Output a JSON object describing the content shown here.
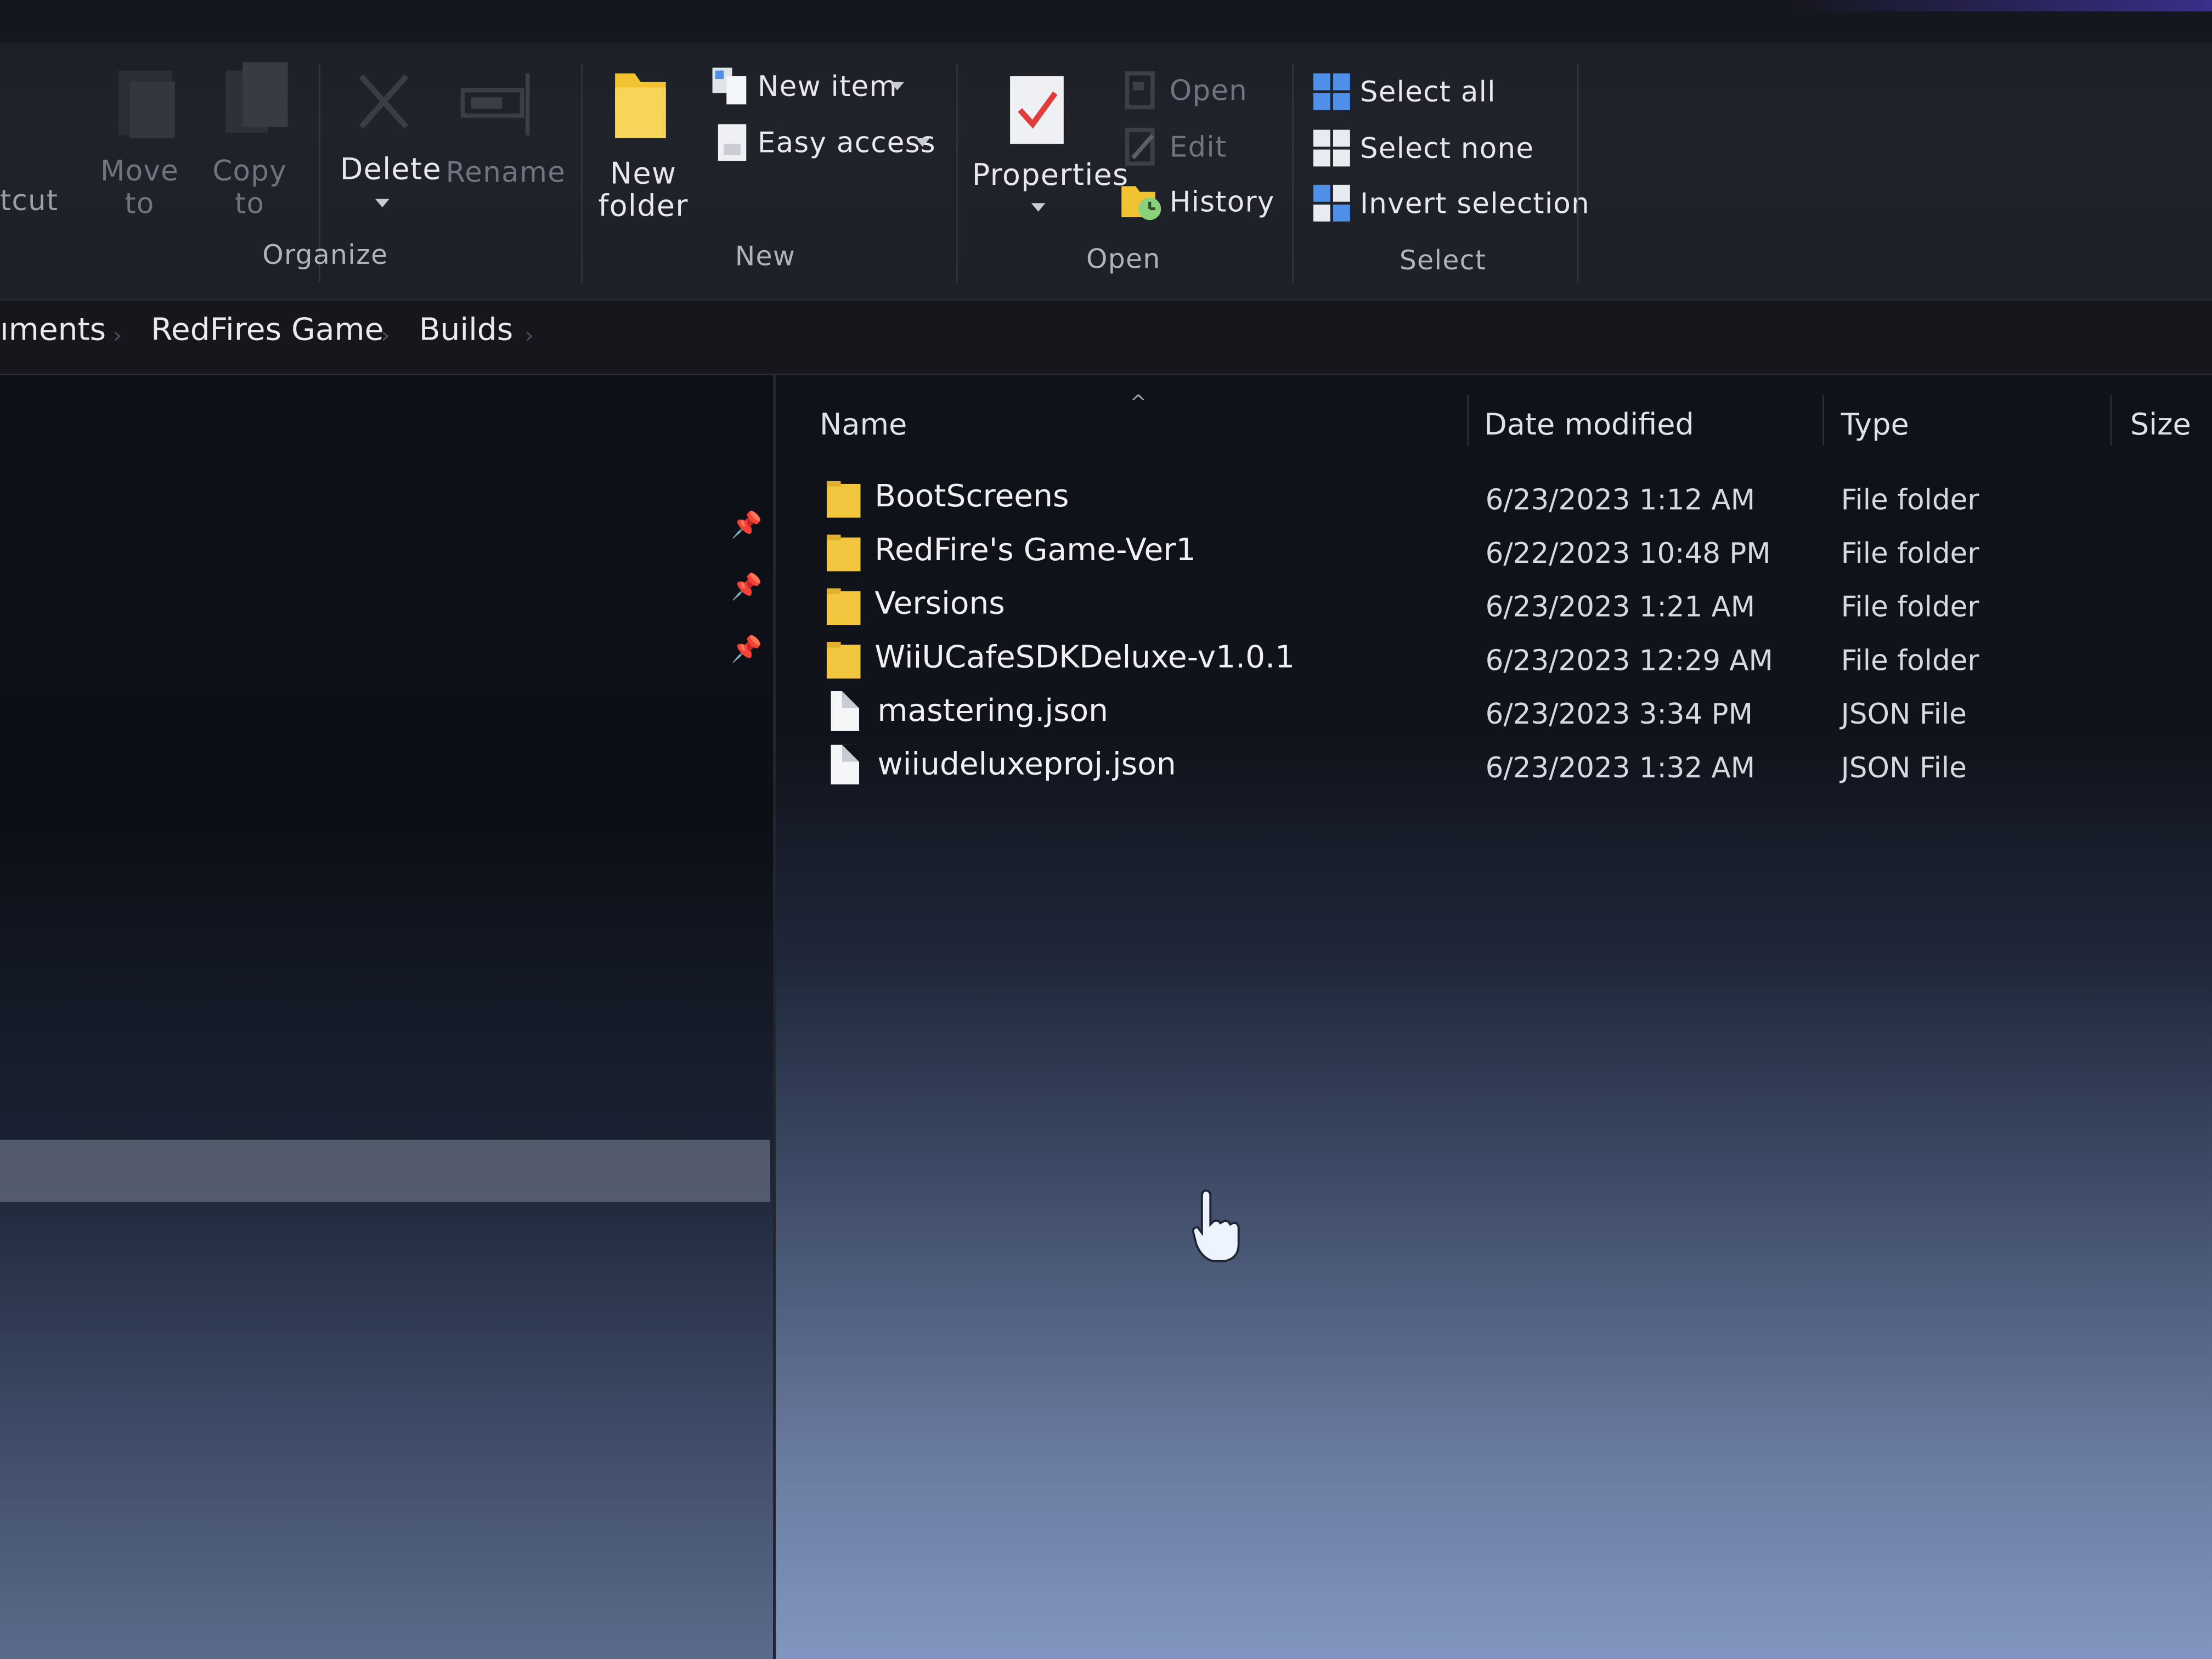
{
  "ribbon": {
    "shortcut_fragment": "tcut",
    "move_to": [
      "Move",
      "to"
    ],
    "copy_to": [
      "Copy",
      "to"
    ],
    "delete_label": "Delete",
    "rename_label": "Rename",
    "new_folder": [
      "New",
      "folder"
    ],
    "new_item_label": "New item",
    "easy_access_label": "Easy access",
    "properties_label": "Properties",
    "open_label": "Open",
    "edit_label": "Edit",
    "history_label": "History",
    "select_all_label": "Select all",
    "select_none_label": "Select none",
    "invert_selection_label": "Invert selection",
    "groups": {
      "organize": "Organize",
      "new": "New",
      "open": "Open",
      "select": "Select"
    }
  },
  "breadcrumb": [
    "ıments",
    "RedFires Game",
    "Builds"
  ],
  "columns": {
    "name": "Name",
    "date_modified": "Date modified",
    "type": "Type",
    "size": "Size"
  },
  "files": [
    {
      "name": "BootScreens",
      "date": "6/23/2023 1:12 AM",
      "type": "File folder",
      "kind": "folder"
    },
    {
      "name": "RedFire's Game-Ver1",
      "date": "6/22/2023 10:48 PM",
      "type": "File folder",
      "kind": "folder"
    },
    {
      "name": "Versions",
      "date": "6/23/2023 1:21 AM",
      "type": "File folder",
      "kind": "folder"
    },
    {
      "name": "WiiUCafeSDKDeluxe-v1.0.1",
      "date": "6/23/2023 12:29 AM",
      "type": "File folder",
      "kind": "folder"
    },
    {
      "name": "mastering.json",
      "date": "6/23/2023 3:34 PM",
      "type": "JSON File",
      "kind": "file"
    },
    {
      "name": "wiiudeluxeproj.json",
      "date": "6/23/2023 1:32 AM",
      "type": "JSON File",
      "kind": "file"
    }
  ],
  "colors": {
    "folder": "#f3c63f",
    "select_icon": "#4f8fe8"
  }
}
